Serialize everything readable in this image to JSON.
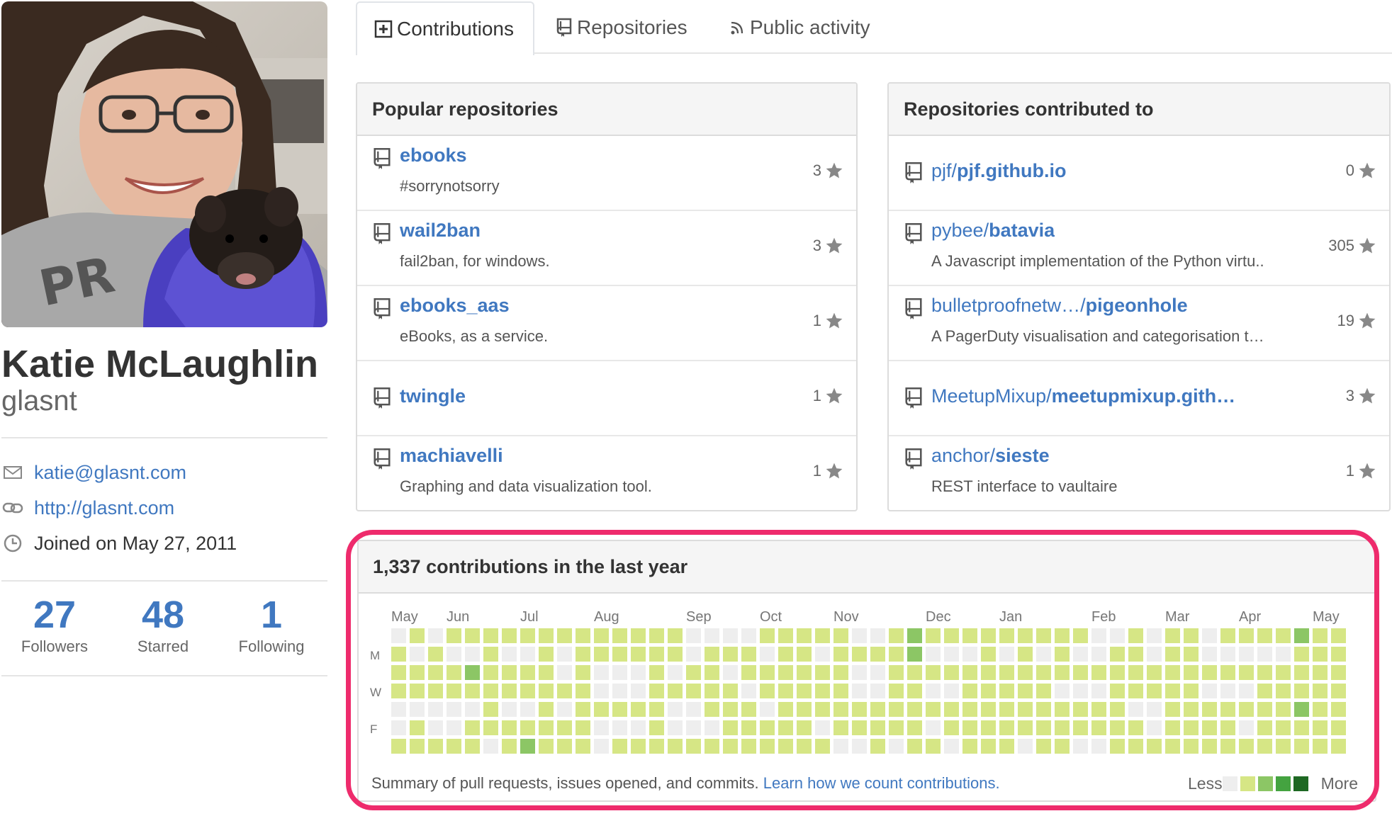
{
  "profile": {
    "full_name": "Katie McLaughlin",
    "username": "glasnt",
    "email": "katie@glasnt.com",
    "website": "http://glasnt.com",
    "joined": "Joined on May 27, 2011",
    "stats": [
      {
        "value": "27",
        "label": "Followers"
      },
      {
        "value": "48",
        "label": "Starred"
      },
      {
        "value": "1",
        "label": "Following"
      }
    ]
  },
  "tabs": [
    {
      "label": "Contributions",
      "icon": "plus-square-icon",
      "selected": true
    },
    {
      "label": "Repositories",
      "icon": "repo-icon",
      "selected": false
    },
    {
      "label": "Public activity",
      "icon": "rss-icon",
      "selected": false
    }
  ],
  "popular": {
    "title": "Popular repositories",
    "repos": [
      {
        "name": "ebooks",
        "desc": "#sorrynotsorry",
        "stars": "3"
      },
      {
        "name": "wail2ban",
        "desc": "fail2ban, for windows.",
        "stars": "3"
      },
      {
        "name": "ebooks_aas",
        "desc": "eBooks, as a service.",
        "stars": "1"
      },
      {
        "name": "twingle",
        "desc": "",
        "stars": "1"
      },
      {
        "name": "machiavelli",
        "desc": "Graphing and data visualization tool.",
        "stars": "1"
      }
    ]
  },
  "contributed": {
    "title": "Repositories contributed to",
    "repos": [
      {
        "owner": "pjf/",
        "name": "pjf.github.io",
        "desc": "",
        "stars": "0"
      },
      {
        "owner": "pybee/",
        "name": "batavia",
        "desc": "A Javascript implementation of the Python virtu..",
        "stars": "305"
      },
      {
        "owner": "bulletproofnetw…/",
        "name": "pigeonhole",
        "desc": "A PagerDuty visualisation and categorisation t…",
        "stars": "19"
      },
      {
        "owner": "MeetupMixup/",
        "name": "meetupmixup.gith…",
        "desc": "",
        "stars": "3"
      },
      {
        "owner": "anchor/",
        "name": "sieste",
        "desc": "REST interface to vaultaire",
        "stars": "1"
      }
    ]
  },
  "contributions": {
    "title": "1,337 contributions in the last year",
    "months": [
      "May",
      "Jun",
      "Jul",
      "Aug",
      "Sep",
      "Oct",
      "Nov",
      "Dec",
      "Jan",
      "Feb",
      "Mar",
      "Apr",
      "May"
    ],
    "day_labels": [
      "M",
      "W",
      "F"
    ],
    "summary": "Summary of pull requests, issues opened, and commits.",
    "learn_link": "Learn how we count contributions.",
    "legend_less": "Less",
    "legend_more": "More",
    "colors": [
      "#eeeeee",
      "#d6e685",
      "#8cc665",
      "#44a340",
      "#1e6823"
    ],
    "levels": [
      "0111001000001000110",
      "1011011000000011100",
      "0111001111011011100",
      "1011001001011010100",
      "1021011101111010101",
      "1111110010111011100",
      "1011011101011111100",
      "1011012211011111100",
      "1111111011011010100",
      "1001011001110101100",
      "1111111010111011000",
      "1100100110111001000",
      "1100101011111000000",
      "1100101001110101100",
      "1111111001011011000",
      "1101001001111111100",
      "0011001011111101200",
      "0111101001111111000",
      "0101111101101110000",
      "0110111001111010000",
      "1011011001111111000",
      "1111111001111111000",
      "1111111001111111000",
      "1011101001011111000",
      "1111110001111110000",
      "0100110001111110100",
      "0100111001111111000",
      "1111110001011111000",
      "2211111001111110000",
      "1010101001111111000",
      "1010110001011111000",
      "1011111001111111000",
      "1111111001011110000",
      "1011111101111111000",
      "1111110101011111000",
      "1011111110101011100",
      "1110111101111111000",
      "1010110111011100000",
      "0010110001110110000",
      "0111111101111101000",
      "1111011101011111000",
      "0011001111111101000",
      "1111111111111111000",
      "1111111101111110000",
      "0010111111011111000",
      "1010111101111111000",
      "1010101111011110000",
      "1011111100111111000",
      "1011111101011100000",
      "2111211101111111000",
      "1111111101011111000",
      "1111111101111111000"
    ]
  }
}
